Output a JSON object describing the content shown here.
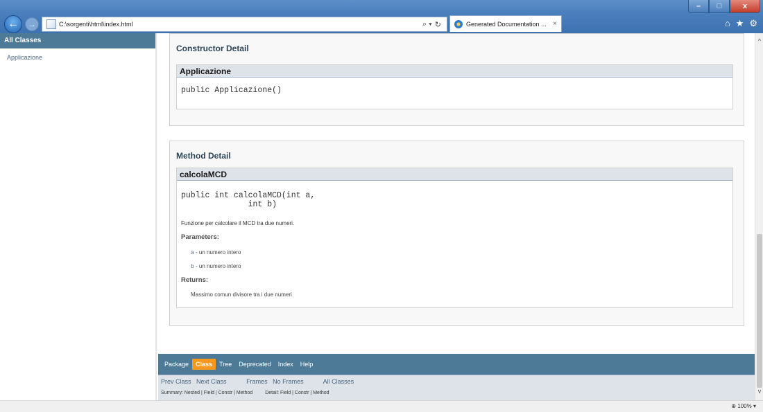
{
  "browser": {
    "url": "C:\\sorgenti\\html\\index.html",
    "tab_title": "Generated Documentation ...",
    "tab_close": "×",
    "window_buttons": {
      "minimize": "–",
      "maximize": "□",
      "close": "x"
    },
    "back_glyph": "←",
    "forward_glyph": "→",
    "search_glyph": "⌕ ▾",
    "refresh_glyph": "↻",
    "tools": {
      "home": "⌂",
      "favorites": "★",
      "settings": "⚙"
    },
    "zoom": "100%"
  },
  "left_frame": {
    "header": "All Classes",
    "classes": [
      "Applicazione"
    ]
  },
  "constructor_detail": {
    "heading": "Constructor Detail",
    "name": "Applicazione",
    "signature": "public Applicazione()"
  },
  "method_detail": {
    "heading": "Method Detail",
    "name": "calcolaMCD",
    "signature": "public int calcolaMCD(int a,\n              int b)",
    "description": "Funzione per calcolare il MCD tra due numeri.",
    "parameters_label": "Parameters:",
    "parameters": [
      {
        "name": "a",
        "desc": " - un numero intero"
      },
      {
        "name": "b",
        "desc": " - un numero intero"
      }
    ],
    "returns_label": "Returns:",
    "returns": "Massimo comun divisore tra i due numeri"
  },
  "navbar": {
    "items": [
      "Package",
      "Class",
      "Tree",
      "Deprecated",
      "Index",
      "Help"
    ],
    "active": "Class"
  },
  "subnav": {
    "prev_class": "Prev Class",
    "next_class": "Next Class",
    "frames": "Frames",
    "no_frames": "No Frames",
    "all_classes": "All Classes",
    "summary_line": "Summary: Nested | Field | Constr | Method",
    "detail_line": "Detail: Field | Constr | Method"
  },
  "scrollbar": {
    "up": "^",
    "down": "v"
  },
  "colors": {
    "titlebar": "#4a7fbd",
    "nav_bar": "#4d7a97",
    "active_tab": "#f8981d",
    "header_strip": "#dee3e9"
  }
}
